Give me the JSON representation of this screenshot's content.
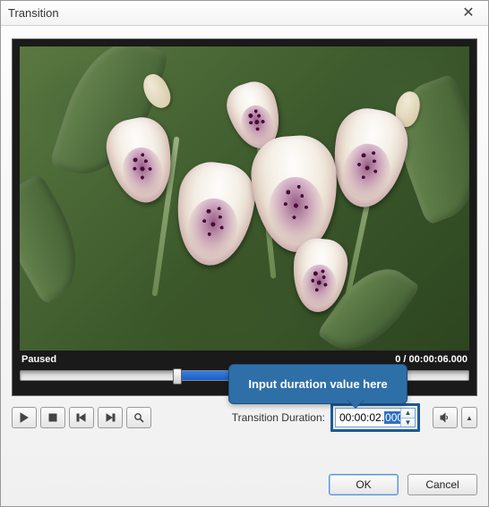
{
  "window": {
    "title": "Transition"
  },
  "status": {
    "state": "Paused",
    "time_hidden": "0",
    "total": "00:00:06.000",
    "separator": " / "
  },
  "duration": {
    "label": "Transition Duration:",
    "value_prefix": "00:00:02.",
    "value_selected": "000"
  },
  "callout": {
    "text": "Input duration value here"
  },
  "buttons": {
    "ok": "OK",
    "cancel": "Cancel"
  },
  "icons": {
    "play": "play",
    "stop": "stop",
    "prev": "prev",
    "next": "next",
    "zoom": "zoom",
    "volume": "volume",
    "up": "▲",
    "down": "▼",
    "close": "✕"
  }
}
